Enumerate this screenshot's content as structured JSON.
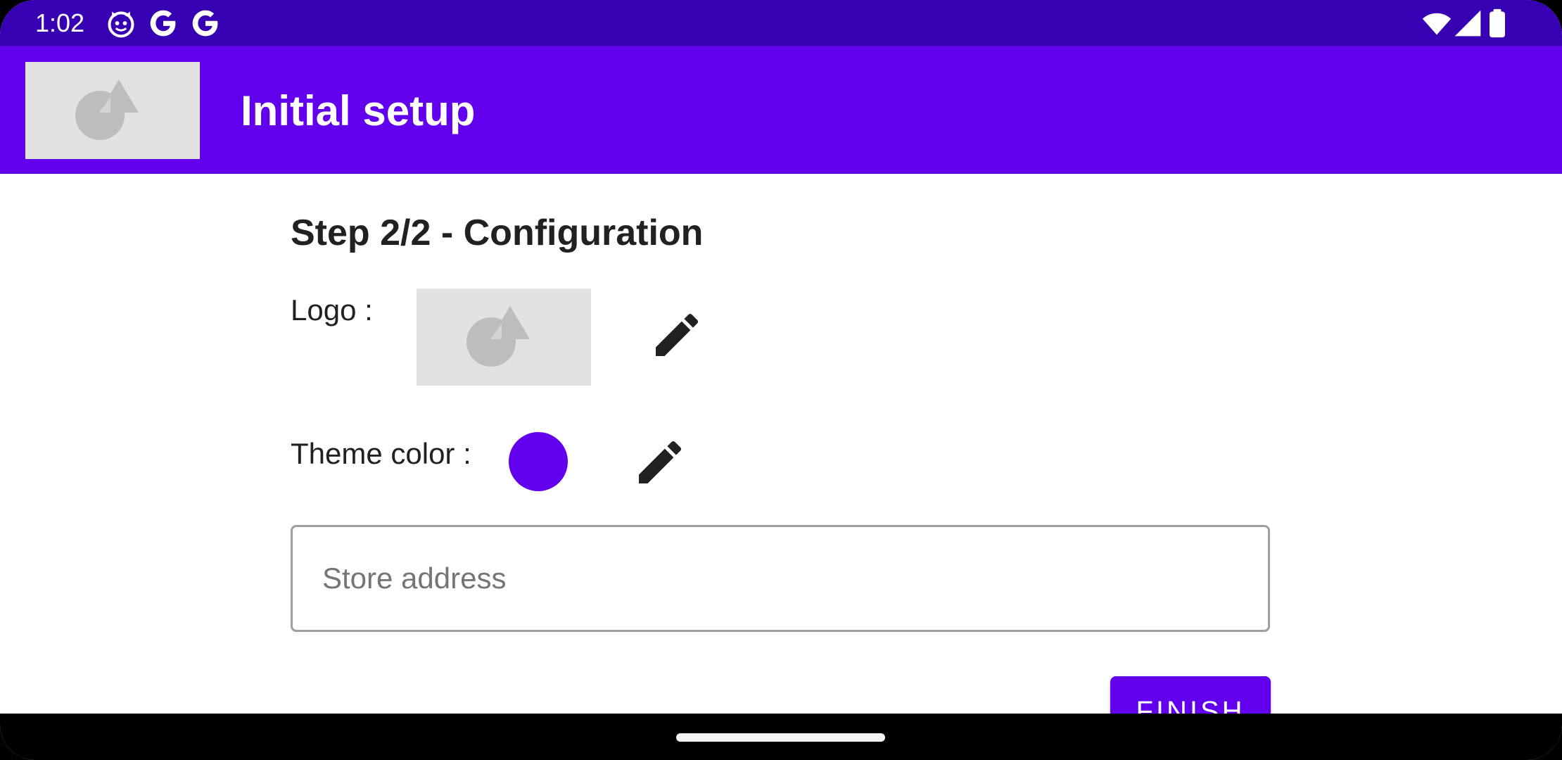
{
  "status_bar": {
    "time": "1:02",
    "icons_left": [
      "cat-notification-icon",
      "google-icon",
      "google-icon"
    ],
    "icons_right": [
      "wifi-icon",
      "cellular-signal-icon",
      "battery-icon"
    ],
    "background_color": "#3700b3"
  },
  "app_bar": {
    "title": "Initial setup",
    "logo": "image-placeholder-icon",
    "background_color": "#6200ee"
  },
  "content": {
    "step_title": "Step 2/2 - Configuration",
    "logo_label": "Logo :",
    "logo_image": "image-placeholder-icon",
    "logo_edit_icon": "pencil-icon",
    "theme_color_label": "Theme color :",
    "theme_color_value": "#6200ee",
    "theme_edit_icon": "pencil-icon",
    "store_address": {
      "placeholder": "Store address",
      "value": ""
    },
    "finish_label": "FINISH"
  },
  "nav_bar": {
    "home_handle": "gesture-home-handle"
  }
}
